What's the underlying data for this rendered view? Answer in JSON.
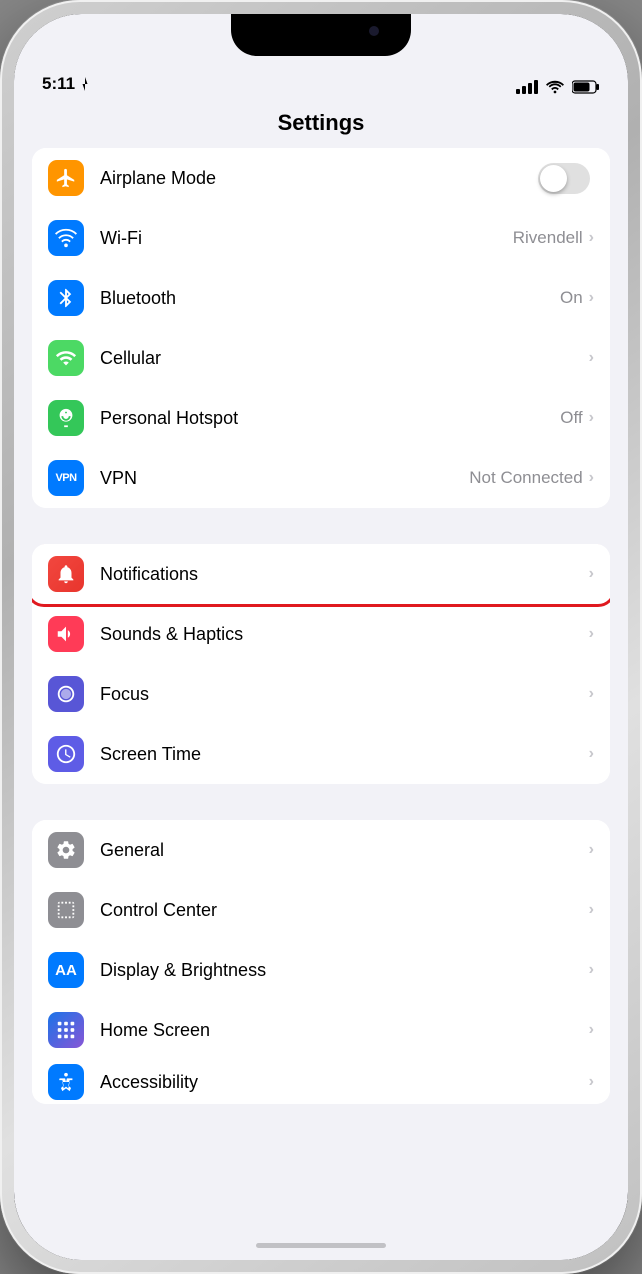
{
  "statusBar": {
    "time": "5:11",
    "locationIcon": "▶",
    "batteryLevel": "75"
  },
  "header": {
    "title": "Settings"
  },
  "groups": [
    {
      "id": "network",
      "rows": [
        {
          "id": "airplane-mode",
          "label": "Airplane Mode",
          "iconColor": "icon-orange",
          "iconSymbol": "airplane",
          "valueType": "toggle",
          "value": "",
          "toggleOn": false
        },
        {
          "id": "wifi",
          "label": "Wi-Fi",
          "iconColor": "icon-blue",
          "iconSymbol": "wifi",
          "valueType": "text",
          "value": "Rivendell",
          "hasChevron": true
        },
        {
          "id": "bluetooth",
          "label": "Bluetooth",
          "iconColor": "icon-bluetooth",
          "iconSymbol": "bluetooth",
          "valueType": "text",
          "value": "On",
          "hasChevron": true
        },
        {
          "id": "cellular",
          "label": "Cellular",
          "iconColor": "icon-green-cell",
          "iconSymbol": "cellular",
          "valueType": "text",
          "value": "",
          "hasChevron": true
        },
        {
          "id": "hotspot",
          "label": "Personal Hotspot",
          "iconColor": "icon-green-hotspot",
          "iconSymbol": "hotspot",
          "valueType": "text",
          "value": "Off",
          "hasChevron": true
        },
        {
          "id": "vpn",
          "label": "VPN",
          "iconColor": "icon-blue-vpn",
          "iconSymbol": "vpn",
          "valueType": "text",
          "value": "Not Connected",
          "hasChevron": true
        }
      ]
    },
    {
      "id": "alerts",
      "rows": [
        {
          "id": "notifications",
          "label": "Notifications",
          "iconColor": "icon-red-notif",
          "iconSymbol": "notifications",
          "valueType": "text",
          "value": "",
          "hasChevron": true,
          "highlighted": true
        },
        {
          "id": "sounds",
          "label": "Sounds & Haptics",
          "iconColor": "icon-pink-sound",
          "iconSymbol": "sounds",
          "valueType": "text",
          "value": "",
          "hasChevron": true
        },
        {
          "id": "focus",
          "label": "Focus",
          "iconColor": "icon-purple-focus",
          "iconSymbol": "focus",
          "valueType": "text",
          "value": "",
          "hasChevron": true
        },
        {
          "id": "screen-time",
          "label": "Screen Time",
          "iconColor": "icon-purple-screen",
          "iconSymbol": "screen-time",
          "valueType": "text",
          "value": "",
          "hasChevron": true
        }
      ]
    },
    {
      "id": "system",
      "rows": [
        {
          "id": "general",
          "label": "General",
          "iconColor": "icon-gray-general",
          "iconSymbol": "general",
          "valueType": "text",
          "value": "",
          "hasChevron": true
        },
        {
          "id": "control-center",
          "label": "Control Center",
          "iconColor": "icon-gray-control",
          "iconSymbol": "control-center",
          "valueType": "text",
          "value": "",
          "hasChevron": true
        },
        {
          "id": "display",
          "label": "Display & Brightness",
          "iconColor": "icon-blue-display",
          "iconSymbol": "display",
          "valueType": "text",
          "value": "",
          "hasChevron": true
        },
        {
          "id": "home-screen",
          "label": "Home Screen",
          "iconColor": "icon-home-screen",
          "iconSymbol": "home-screen",
          "valueType": "text",
          "value": "",
          "hasChevron": true
        },
        {
          "id": "accessibility",
          "label": "Accessibility",
          "iconColor": "icon-accessibility",
          "iconSymbol": "accessibility",
          "valueType": "text",
          "value": "",
          "hasChevron": true
        }
      ]
    }
  ]
}
